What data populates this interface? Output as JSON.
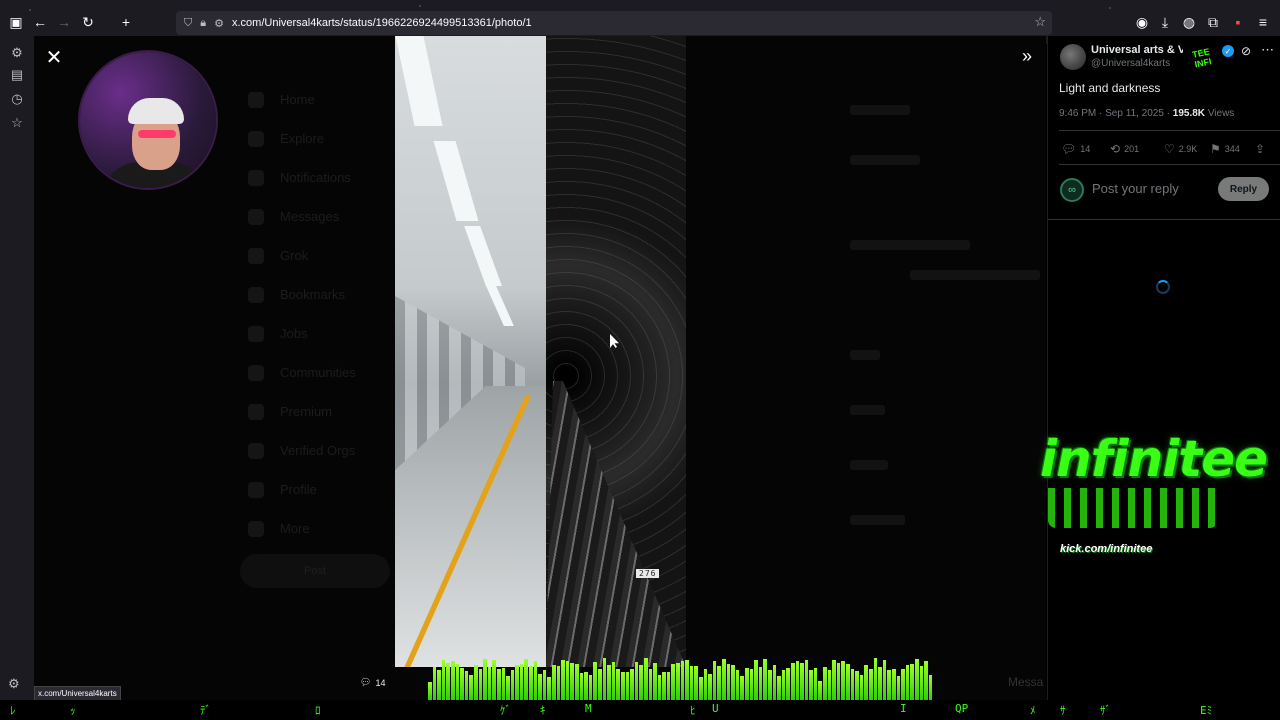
{
  "browser": {
    "url": "x.com/Universal4karts/status/1966226924499513361/photo/1",
    "status_link": "x.com/Universal4karts"
  },
  "tweet": {
    "author_name": "Universal arts & V",
    "author_handle": "@Universal4karts",
    "text": "Light and darkness",
    "time_date": "9:46 PM · Sep 11, 2025 ·",
    "views_count": "195.8K",
    "views_label": "Views",
    "replies": "14",
    "reposts": "201",
    "likes": "2.9K",
    "bookmarks": "344",
    "reply_placeholder": "Post your reply",
    "reply_button": "Reply"
  },
  "overlay": {
    "logo_text": "infinitee",
    "logo_url": "kick.com/infinitee",
    "sticker_text": "TEE INFI",
    "comment_count": "14"
  },
  "photo": {
    "track_sign": "276"
  },
  "ghost_nav": [
    "Home",
    "Explore",
    "Notifications",
    "Messages",
    "Grok",
    "Bookmarks",
    "Jobs",
    "Communities",
    "Premium",
    "Verified Orgs",
    "Profile",
    "More"
  ],
  "ghost_post": "Post",
  "ghost_message": "Messa",
  "icons": {
    "colors": {
      "accent": "#1d9bf0",
      "neon": "#39ff14",
      "reply_button_bg": "#787a7a"
    }
  }
}
